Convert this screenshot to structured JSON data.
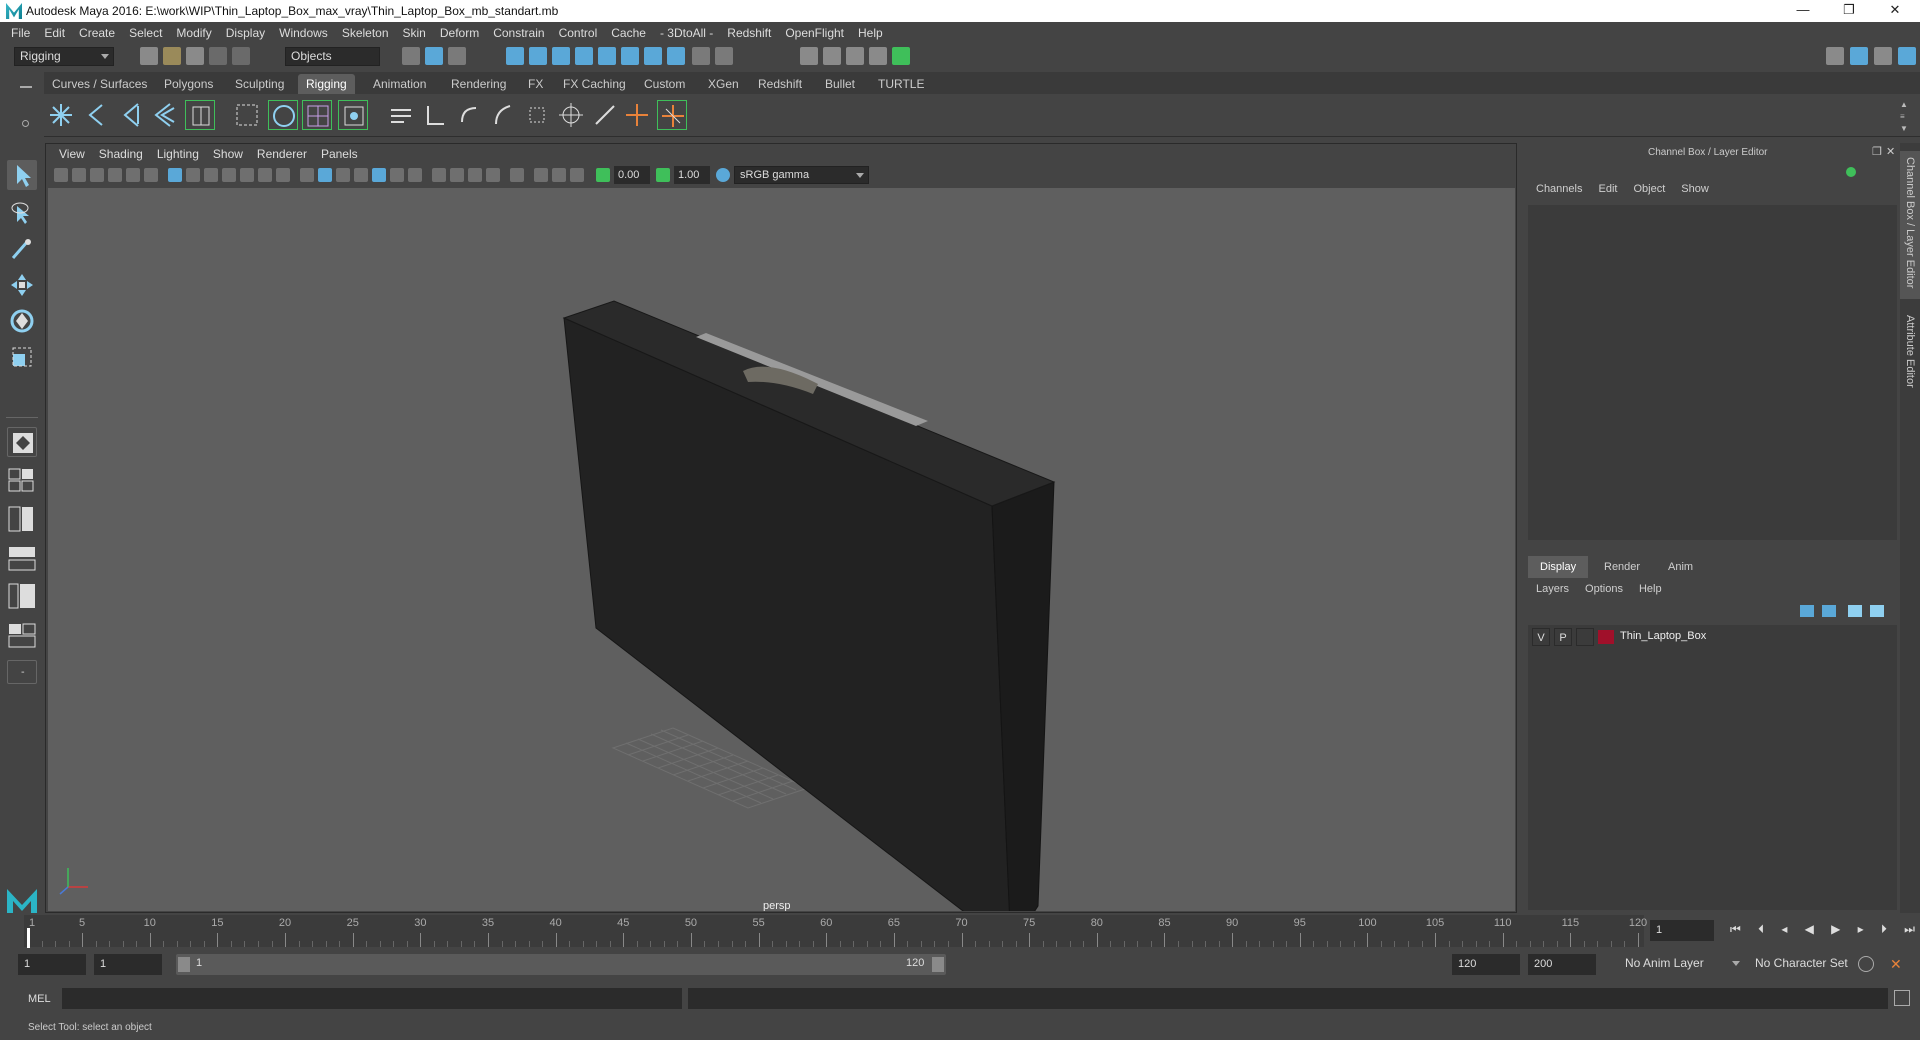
{
  "window": {
    "title": "Autodesk Maya 2016: E:\\work\\WIP\\Thin_Laptop_Box_max_vray\\Thin_Laptop_Box_mb_standart.mb",
    "controls": [
      "—",
      "❐",
      "✕"
    ]
  },
  "menubar": [
    "File",
    "Edit",
    "Create",
    "Select",
    "Modify",
    "Display",
    "Windows",
    "Skeleton",
    "Skin",
    "Deform",
    "Constrain",
    "Control",
    "Cache",
    "- 3DtoAll -",
    "Redshift",
    "OpenFlight",
    "Help"
  ],
  "statusline": {
    "menuset": "Rigging",
    "selection_mode": "Objects"
  },
  "shelf": {
    "tabs": [
      "Curves / Surfaces",
      "Polygons",
      "Sculpting",
      "Rigging",
      "Animation",
      "Rendering",
      "FX",
      "FX Caching",
      "Custom",
      "XGen",
      "Redshift",
      "Bullet",
      "TURTLE"
    ],
    "active_tab": "Rigging"
  },
  "viewport": {
    "menu": [
      "View",
      "Shading",
      "Lighting",
      "Show",
      "Renderer",
      "Panels"
    ],
    "exposure": "0.00",
    "gamma": "1.00",
    "color_space": "sRGB gamma",
    "camera_label": "persp"
  },
  "channel_box": {
    "header": "Channel Box / Layer Editor",
    "menu": [
      "Channels",
      "Edit",
      "Object",
      "Show"
    ]
  },
  "layer_editor": {
    "tabs": [
      "Display",
      "Render",
      "Anim"
    ],
    "active_tab": "Display",
    "menu": [
      "Layers",
      "Options",
      "Help"
    ],
    "layers": [
      {
        "visible": "V",
        "playback": "P",
        "color": "#a0102a",
        "name": "Thin_Laptop_Box"
      }
    ]
  },
  "side_tabs": [
    "Channel Box / Layer Editor",
    "Attribute Editor"
  ],
  "timeline": {
    "labels": [
      "1",
      "5",
      "10",
      "15",
      "20",
      "25",
      "30",
      "35",
      "40",
      "45",
      "50",
      "55",
      "60",
      "65",
      "70",
      "75",
      "80",
      "85",
      "90",
      "95",
      "100",
      "105",
      "110",
      "115",
      "120"
    ],
    "current_frame": "1"
  },
  "range": {
    "start": "1",
    "playback_start": "1",
    "slider_start": "1",
    "slider_end": "120",
    "playback_end": "120",
    "end": "200",
    "anim_layer": "No Anim Layer",
    "character_set": "No Character Set"
  },
  "command_line": {
    "language": "MEL"
  },
  "help_line": "Select Tool: select an object",
  "colors": {
    "accent_active_tab": "#5d5d5d",
    "layer_color": "#a0102a",
    "icon_blue": "#5aa8d8",
    "icon_green": "#3fbf5a"
  }
}
